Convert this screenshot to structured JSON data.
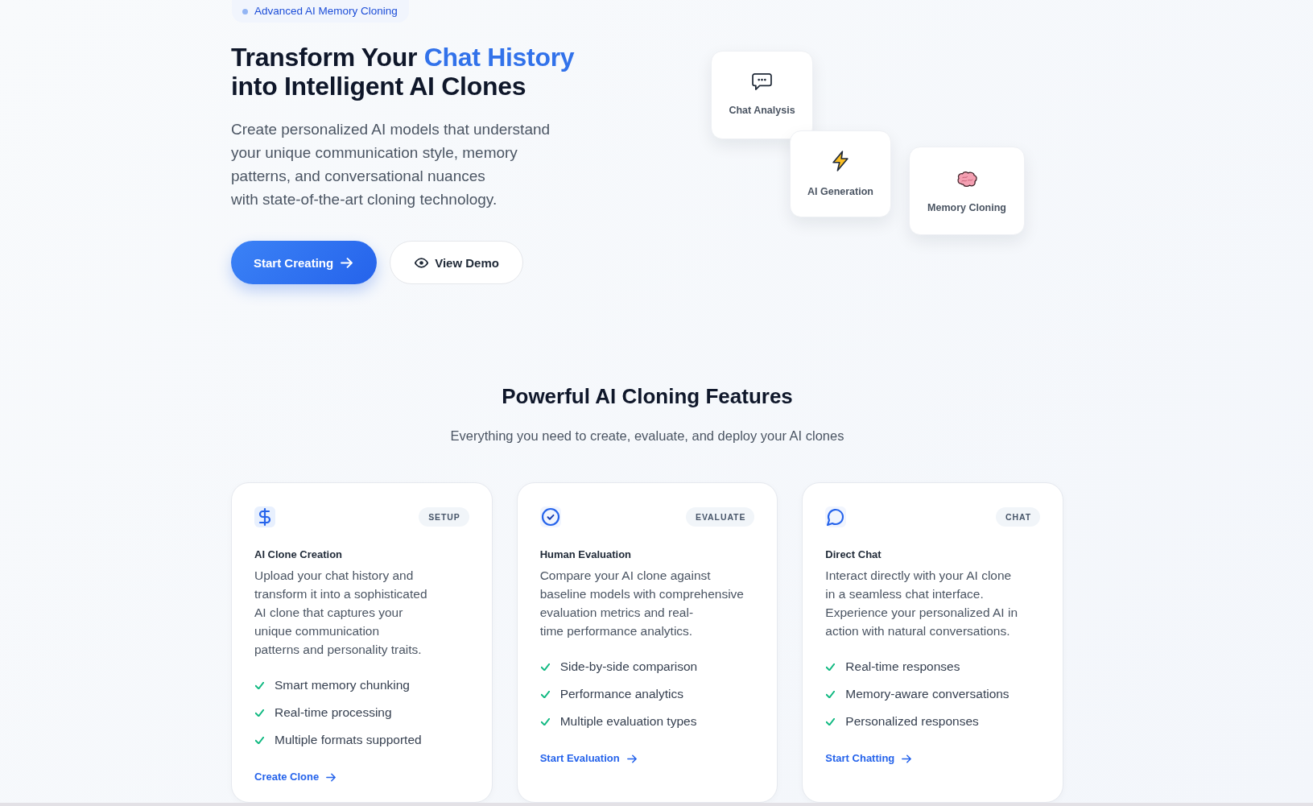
{
  "hero": {
    "badge": "Advanced AI Memory Cloning",
    "title": {
      "lead": "Transform Your",
      "highlight": "Chat History",
      "rest": "into Intelligent AI Clones"
    },
    "description": "Create personalized AI models that understand\nyour unique communication style, memory\npatterns, and conversational nuances\nwith state-of-the-art cloning technology.",
    "buttons": [
      {
        "label": "Start Creating",
        "kind": "primary"
      },
      {
        "label": "View Demo",
        "kind": "secondary"
      }
    ],
    "floating_cards": [
      {
        "label": "Chat Analysis"
      },
      {
        "label": "AI Generation"
      },
      {
        "label": "Memory Cloning"
      }
    ]
  },
  "features": {
    "title": "Powerful AI Cloning Features",
    "subtitle": "Everything you need to create, evaluate, and deploy your AI clones",
    "cards": [
      {
        "tag": "SETUP",
        "title": "AI Clone Creation",
        "description": "Upload your chat history and\ntransform it into a sophisticated\nAI clone that captures your\nunique communication\npatterns and personality traits.",
        "items": [
          "Smart memory chunking",
          "Real-time processing",
          "Multiple formats supported"
        ],
        "link": "Create Clone"
      },
      {
        "tag": "EVALUATE",
        "title": "Human Evaluation",
        "description": "Compare your AI clone against\nbaseline models with comprehensive\nevaluation metrics and real-\ntime performance analytics.",
        "items": [
          "Side-by-side comparison",
          "Performance analytics",
          "Multiple evaluation types"
        ],
        "link": "Start Evaluation"
      },
      {
        "tag": "CHAT",
        "title": "Direct Chat",
        "description": "Interact directly with your AI clone\nin a seamless chat interface.\nExperience your personalized AI in\naction with natural conversations.",
        "items": [
          "Real-time responses",
          "Memory-aware conversations",
          "Personalized responses"
        ],
        "link": "Start Chatting"
      }
    ]
  }
}
